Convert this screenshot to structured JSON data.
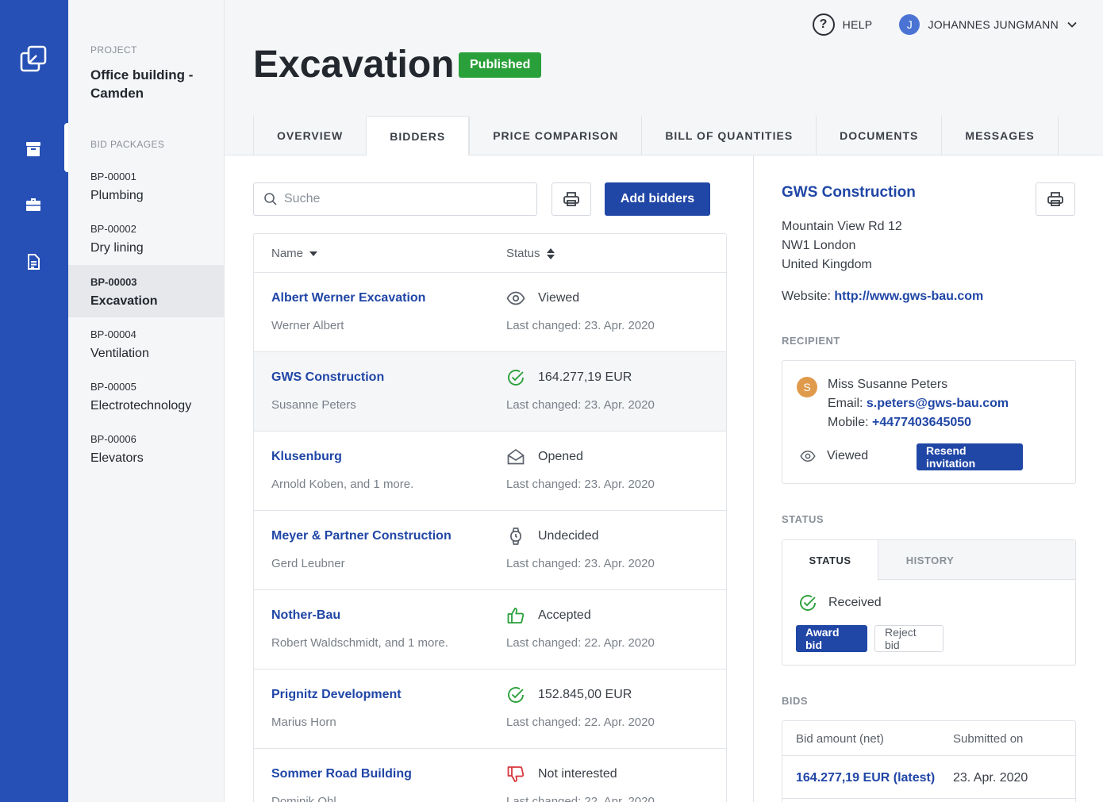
{
  "colors": {
    "rail": "#2650b5",
    "link": "#2046a6",
    "primary_button": "#2046a6",
    "published": "#2aa03a",
    "success": "#2aa03a",
    "danger": "#d9363e",
    "avatar_user": "#4a73d4",
    "avatar_recipient": "#e09a4c"
  },
  "rail": {
    "icons": [
      "copy-logo-icon",
      "archive-icon",
      "briefcase-icon",
      "document-icon"
    ]
  },
  "project": {
    "label": "PROJECT",
    "name": "Office building - Camden",
    "packages_label": "BID PACKAGES",
    "packages": [
      {
        "code": "BP-00001",
        "name": "Plumbing"
      },
      {
        "code": "BP-00002",
        "name": "Dry lining"
      },
      {
        "code": "BP-00003",
        "name": "Excavation",
        "active": true
      },
      {
        "code": "BP-00004",
        "name": "Ventilation"
      },
      {
        "code": "BP-00005",
        "name": "Electrotechnology"
      },
      {
        "code": "BP-00006",
        "name": "Elevators"
      }
    ]
  },
  "header": {
    "help": "HELP",
    "user_initial": "J",
    "user_name": "JOHANNES JUNGMANN",
    "title": "Excavation",
    "badge": "Published"
  },
  "tabs": [
    "OVERVIEW",
    "BIDDERS",
    "PRICE COMPARISON",
    "BILL OF QUANTITIES",
    "DOCUMENTS",
    "MESSAGES"
  ],
  "active_tab": "BIDDERS",
  "bidders": {
    "search_placeholder": "Suche",
    "add_button": "Add bidders",
    "col_name": "Name",
    "col_status": "Status",
    "rows": [
      {
        "company": "Albert Werner Excavation",
        "person": "Werner Albert",
        "icon": "eye-icon",
        "status": "Viewed",
        "changed": "Last changed: 23. Apr. 2020"
      },
      {
        "company": "GWS Construction",
        "person": "Susanne Peters",
        "icon": "check-circle-icon",
        "status": "164.277,19 EUR",
        "changed": "Last changed: 23. Apr. 2020",
        "selected": true
      },
      {
        "company": "Klusenburg",
        "person": "Arnold Koben, and 1 more.",
        "icon": "envelope-open-icon",
        "status": "Opened",
        "changed": "Last changed: 23. Apr. 2020"
      },
      {
        "company": "Meyer & Partner Construction",
        "person": "Gerd Leubner",
        "icon": "watch-icon",
        "status": "Undecided",
        "changed": "Last changed: 23. Apr. 2020"
      },
      {
        "company": "Nother-Bau",
        "person": "Robert Waldschmidt, and 1 more.",
        "icon": "thumbs-up-icon",
        "status": "Accepted",
        "changed": "Last changed: 22. Apr. 2020"
      },
      {
        "company": "Prignitz Development",
        "person": "Marius Horn",
        "icon": "check-circle-icon",
        "status": "152.845,00 EUR",
        "changed": "Last changed: 22. Apr. 2020"
      },
      {
        "company": "Sommer Road Building",
        "person": "Dominik Ohl",
        "icon": "thumbs-down-icon",
        "status": "Not interested",
        "changed": "Last changed: 22. Apr. 2020"
      }
    ]
  },
  "detail": {
    "company": "GWS Construction",
    "address": [
      "Mountain View Rd 12",
      "NW1 London",
      "United Kingdom"
    ],
    "website_label": "Website:",
    "website": "http://www.gws-bau.com",
    "recipient_label": "RECIPIENT",
    "recipient": {
      "initial": "S",
      "name": "Miss Susanne Peters",
      "email_label": "Email:",
      "email": "s.peters@gws-bau.com",
      "mobile_label": "Mobile:",
      "mobile": "+4477403645050",
      "viewed": "Viewed",
      "resend": "Resend invitation"
    },
    "status_label": "STATUS",
    "status_tabs": [
      "STATUS",
      "HISTORY"
    ],
    "status_value": "Received",
    "award": "Award bid",
    "reject": "Reject bid",
    "bids_label": "BIDS",
    "bids_head": [
      "Bid amount (net)",
      "Submitted on"
    ],
    "bids_rows": [
      {
        "amount": "164.277,19 EUR (latest)",
        "date": "23. Apr. 2020"
      }
    ]
  }
}
